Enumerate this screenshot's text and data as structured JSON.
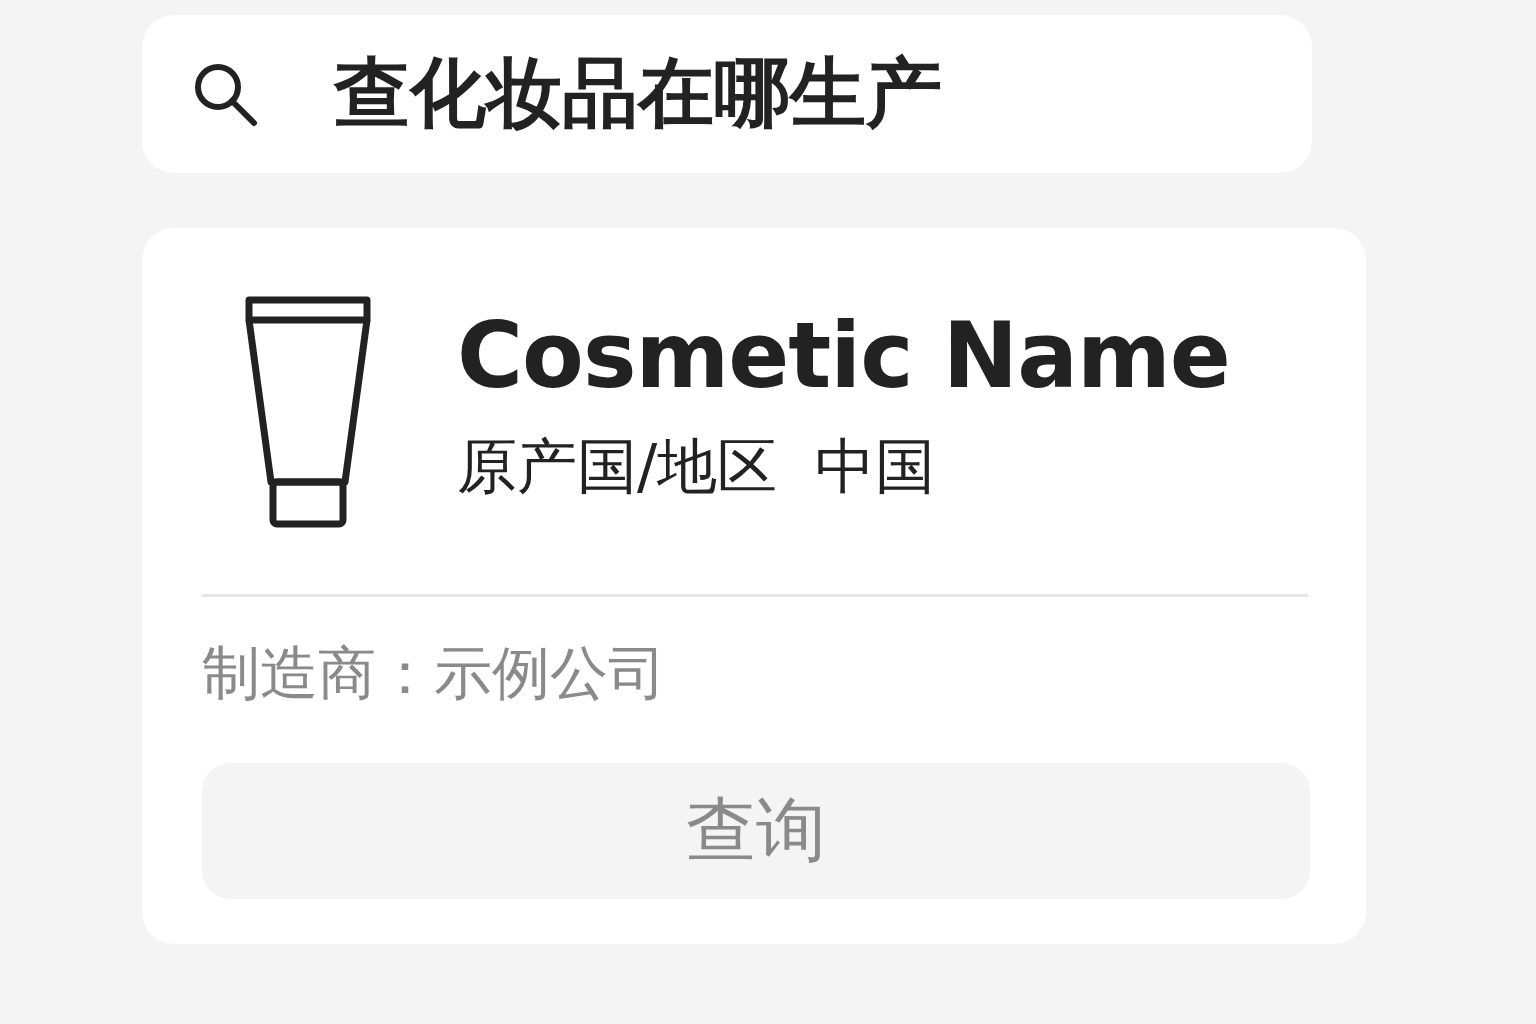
{
  "search": {
    "value": "查化妆品在哪生产"
  },
  "product": {
    "name": "Cosmetic Name",
    "origin_label": "原产国/地区",
    "origin_value": "中国",
    "manufacturer": "制造商：示例公司"
  },
  "button": {
    "label": "查询"
  }
}
